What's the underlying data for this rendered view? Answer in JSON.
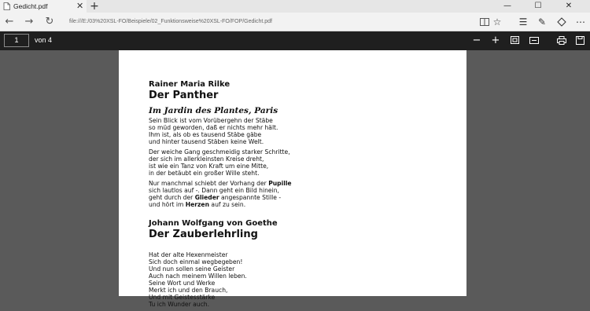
{
  "tab": {
    "title": "Gedicht.pdf",
    "close_glyph": "✕",
    "new_tab_glyph": "+"
  },
  "window_controls": {
    "minimize": "—",
    "maximize": "☐",
    "close": "✕"
  },
  "nav": {
    "back": "←",
    "forward": "→",
    "refresh": "↻",
    "address": "file:///E:/03%20XSL-FO/Beispiele/02_Funktionsweise%20XSL-FO/FOP/Gedicht.pdf"
  },
  "tools": {
    "reading_view": "📖",
    "favorite": "☆",
    "hub": "☰",
    "notes": "✎",
    "share": "⇪",
    "more": "⋯"
  },
  "pdf_toolbar": {
    "page_number": "1",
    "page_count_label": "von 4",
    "zoom_out": "−",
    "zoom_in": "+",
    "fit": "⧈",
    "two_page": "▭",
    "print": "⎙",
    "save": "💾"
  },
  "document": {
    "poem1": {
      "author": "Rainer Maria Rilke",
      "title": "Der Panther",
      "subtitle": "Im Jardin des Plantes, Paris",
      "stanza1": [
        "Sein Blick ist vom Vorübergehn der Stäbe",
        "so müd geworden, daß er nichts mehr hält.",
        "Ihm ist, als ob es tausend Stäbe gäbe",
        "und hinter tausend Stäben keine Welt."
      ],
      "stanza2": [
        "Der weiche Gang geschmeidig starker Schritte,",
        "der sich im allerkleinsten Kreise dreht,",
        "ist wie ein Tanz von Kraft um eine Mitte,",
        "in der betäubt ein großer Wille steht."
      ],
      "stanza3": {
        "l1_pre": "Nur manchmal schiebt der Vorhang der ",
        "l1_bold": "Pupille",
        "l2": "sich lautlos auf -. Dann geht ein Bild hinein,",
        "l3_pre": "geht durch der ",
        "l3_bold": "Glieder",
        "l3_post": " angespannte Stille -",
        "l4_pre": "und hört im ",
        "l4_bold": "Herzen",
        "l4_post": " auf zu sein."
      }
    },
    "poem2": {
      "author": "Johann Wolfgang von Goethe",
      "title": "Der Zauberlehrling",
      "stanza1": [
        "Hat der alte Hexenmeister",
        "Sich doch einmal wegbegeben!",
        "Und nun sollen seine Geister",
        "Auch nach meinem Willen leben.",
        "Seine Wort und Werke",
        "Merkt ich und den Brauch,",
        "Und mit Geistesstärke",
        "Tu ich Wunder auch."
      ]
    }
  },
  "colors": {
    "tabbar": "#e6e6e6",
    "navbar": "#f2f2f2",
    "pdf_toolbar": "#1f1f1f",
    "viewer_bg": "#5a5a5a",
    "page_bg": "#ffffff"
  }
}
